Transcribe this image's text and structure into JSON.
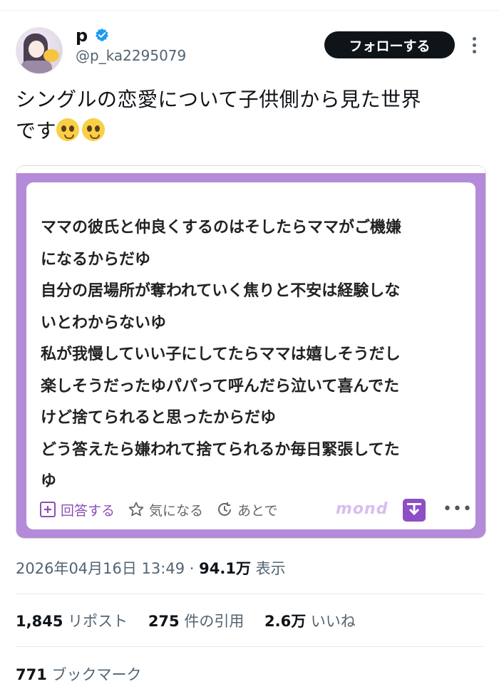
{
  "author": {
    "display_name": "p",
    "handle": "@p_ka2295079",
    "verified": true,
    "avatar_icon": "anime-girl-avatar"
  },
  "follow_label": "フォローする",
  "tweet": {
    "line1": "シングルの恋愛について子供側から見た世界",
    "line2": "です"
  },
  "card": {
    "lines": [
      "ママの彼氏と仲良くするのはそしたらママがご機嫌",
      "になるからだゆ",
      "自分の居場所が奪われていく焦りと不安は経験しな",
      "いとわからないゆ",
      "私が我慢していい子にしてたらママは嬉しそうだし",
      "楽しそうだったゆパパって呼んだら泣いて喜んでた",
      "けど捨てられると思ったからだゆ",
      "どう答えたら嫌われて捨てられるか毎日緊張してた",
      "ゆ"
    ],
    "actions": {
      "answer": "回答する",
      "interested": "気になる",
      "later": "あとで"
    },
    "brand": "mond",
    "more": "•••",
    "accent_color": "#b48bd8"
  },
  "meta": {
    "datetime": "2026年04月16日 13:49",
    "separator": " · ",
    "views": "94.1万",
    "views_label": " 表示"
  },
  "stats": {
    "reposts": "1,845",
    "reposts_label": " リポスト",
    "quotes": "275",
    "quotes_label": " 件の引用",
    "likes": "2.6万",
    "likes_label": " いいね",
    "bookmarks": "771",
    "bookmarks_label": " ブックマーク"
  }
}
